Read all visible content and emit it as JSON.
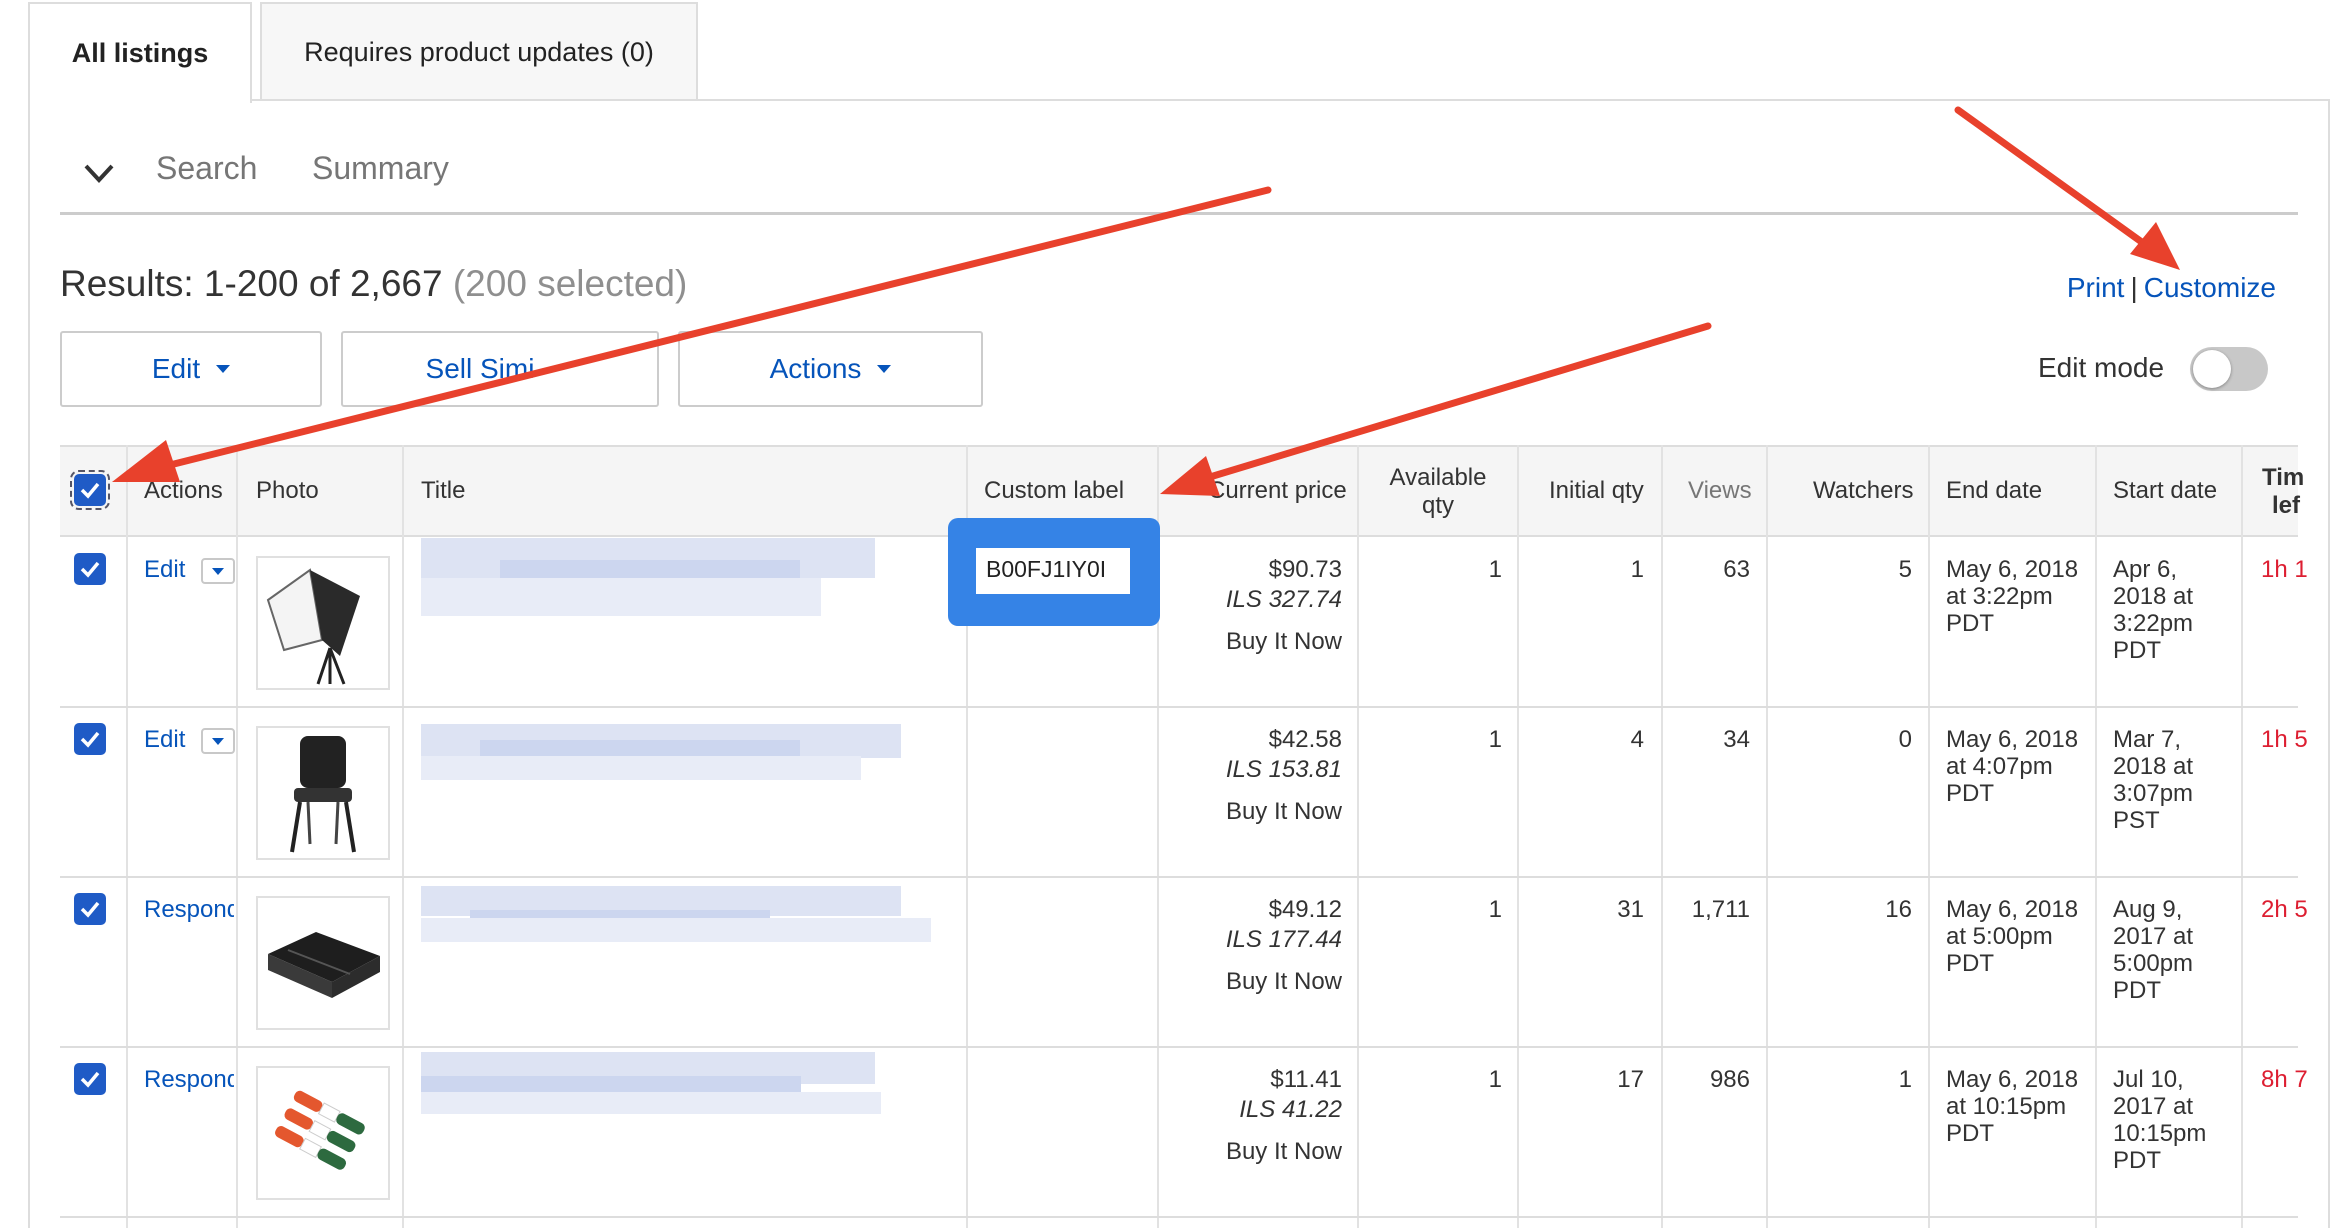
{
  "tabs": {
    "all_listings": "All listings",
    "requires_updates": "Requires product updates (0)"
  },
  "subnav": {
    "search": "Search",
    "summary": "Summary"
  },
  "results": {
    "text": "Results: 1-200 of 2,667",
    "selected": "(200 selected)"
  },
  "links": {
    "print": "Print",
    "separator": "|",
    "customize": "Customize"
  },
  "toolbar": {
    "edit": "Edit",
    "sell_similar": "Sell Simi",
    "actions": "Actions",
    "edit_mode": "Edit mode"
  },
  "columns": {
    "actions": "Actions",
    "photo": "Photo",
    "title": "Title",
    "custom_label": "Custom label",
    "current_price": "Current price",
    "available_qty_1": "Available",
    "available_qty_2": "qty",
    "initial_qty": "Initial qty",
    "views": "Views",
    "watchers": "Watchers",
    "end_date": "End date",
    "start_date": "Start date",
    "time_left_1": "Tim",
    "time_left_2": "lef"
  },
  "rows": [
    {
      "action": "Edit",
      "custom_label": "B00FJ1IY0I",
      "price": "$90.73",
      "price_ils": "ILS 327.74",
      "format": "Buy It Now",
      "available_qty": "1",
      "initial_qty": "1",
      "views": "63",
      "watchers": "5",
      "end_1": "May 6, 2018",
      "end_2": "at 3:22pm",
      "end_3": "PDT",
      "start_1": "Apr 6,",
      "start_2": "2018 at",
      "start_3": "3:22pm",
      "start_4": "PDT",
      "time_left": "1h 1"
    },
    {
      "action": "Edit",
      "custom_label": "",
      "price": "$42.58",
      "price_ils": "ILS 153.81",
      "format": "Buy It Now",
      "available_qty": "1",
      "initial_qty": "4",
      "views": "34",
      "watchers": "0",
      "end_1": "May 6, 2018",
      "end_2": "at 4:07pm",
      "end_3": "PDT",
      "start_1": "Mar 7,",
      "start_2": "2018 at",
      "start_3": "3:07pm",
      "start_4": "PST",
      "time_left": "1h 5"
    },
    {
      "action": "Respond",
      "custom_label": "",
      "price": "$49.12",
      "price_ils": "ILS 177.44",
      "format": "Buy It Now",
      "available_qty": "1",
      "initial_qty": "31",
      "views": "1,711",
      "watchers": "16",
      "end_1": "May 6, 2018",
      "end_2": "at 5:00pm",
      "end_3": "PDT",
      "start_1": "Aug 9,",
      "start_2": "2017 at",
      "start_3": "5:00pm",
      "start_4": "PDT",
      "time_left": "2h 5"
    },
    {
      "action": "Respond",
      "custom_label": "",
      "price": "$11.41",
      "price_ils": "ILS 41.22",
      "format": "Buy It Now",
      "available_qty": "1",
      "initial_qty": "17",
      "views": "986",
      "watchers": "1",
      "end_1": "May 6, 2018",
      "end_2": "at 10:15pm",
      "end_3": "PDT",
      "start_1": "Jul 10,",
      "start_2": "2017 at",
      "start_3": "10:15pm",
      "start_4": "PDT",
      "time_left": "8h 7"
    }
  ],
  "colors": {
    "link": "#0654ba",
    "checkbox": "#1f5bc6",
    "highlight": "#3583e6",
    "annotation_arrow": "#e8412c",
    "time_left": "#dd1e31"
  },
  "icons": {
    "collapse": "chevron-down-icon",
    "dropdown": "caret-down-icon",
    "checked": "checkmark-icon",
    "annotation": "arrow-icon"
  }
}
